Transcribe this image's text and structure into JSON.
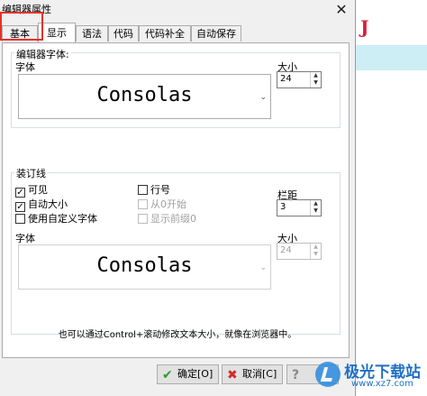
{
  "window": {
    "title": "编辑器属性",
    "close_glyph": "✕"
  },
  "tabs": [
    {
      "label": "基本"
    },
    {
      "label": "显示"
    },
    {
      "label": "语法"
    },
    {
      "label": "代码"
    },
    {
      "label": "代码补全"
    },
    {
      "label": "自动保存"
    }
  ],
  "active_tab": "显示",
  "editor_font_section": {
    "group_title": "编辑器字体:",
    "font_label": "字体",
    "font_value": "Consolas",
    "size_label": "大小",
    "size_value": "24"
  },
  "gutter_section": {
    "group_title": "装订线",
    "visible": {
      "label": "可见",
      "checked": true
    },
    "auto_size": {
      "label": "自动大小",
      "checked": true
    },
    "custom_font": {
      "label": "使用自定义字体",
      "checked": false
    },
    "line_numbers": {
      "label": "行号",
      "checked": false
    },
    "start_from_zero": {
      "label": "从0开始",
      "checked": false,
      "disabled": true
    },
    "leading_zeros": {
      "label": "显示前缀0",
      "checked": false,
      "disabled": true
    },
    "gutter_width_label": "栏距",
    "gutter_width_value": "3",
    "font_label": "字体",
    "font_value": "Consolas",
    "size_label": "大小",
    "size_value": "24"
  },
  "hint_text": "也可以通过Control+滚动修改文本大小，就像在浏览器中。",
  "buttons": {
    "ok": "确定[O]",
    "cancel": "取消[C]"
  },
  "watermark": {
    "title": "极光下载站",
    "url": "www.xz7.com"
  },
  "colors": {
    "highlight": "#e8302a",
    "background_strip": "#cdeef4"
  }
}
